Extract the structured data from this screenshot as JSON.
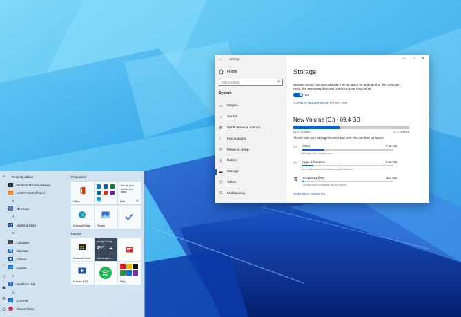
{
  "settings": {
    "app_title": "Settings",
    "home_label": "Home",
    "search_placeholder": "Find a setting",
    "section_label": "System",
    "nav": [
      {
        "label": "Display",
        "icon": "display-icon"
      },
      {
        "label": "Sound",
        "icon": "sound-icon"
      },
      {
        "label": "Notifications & actions",
        "icon": "notifications-icon"
      },
      {
        "label": "Focus assist",
        "icon": "focus-assist-icon"
      },
      {
        "label": "Power & sleep",
        "icon": "power-icon"
      },
      {
        "label": "Battery",
        "icon": "battery-icon"
      },
      {
        "label": "Storage",
        "icon": "storage-icon",
        "active": true
      },
      {
        "label": "Tablet",
        "icon": "tablet-icon"
      },
      {
        "label": "Multitasking",
        "icon": "multitasking-icon"
      }
    ],
    "page_title": "Storage",
    "sense_description": "Storage Sense can automatically free up space by getting rid of files you don't need, like temporary files and content in your recycle bin.",
    "toggle_state": "On",
    "configure_link": "Configure Storage Sense or run it now",
    "volume": {
      "title": "New Volume (C:) - 69.4 GB",
      "used_label": "21.6 GB used",
      "free_label": "57.6 GB free",
      "used_fraction": 0.4,
      "info": "This is how your storage is used and how you can free up space."
    },
    "categories": [
      {
        "name": "Other",
        "size": "7.49 GB",
        "sub": "Manage other large folders",
        "fraction": 0.24,
        "icon": "folder-icon"
      },
      {
        "name": "Apps & features",
        "size": "2.85 GB",
        "sub": "Uninstall unused or undesired apps & features",
        "fraction": 0.12,
        "icon": "apps-icon"
      },
      {
        "name": "Temporary files",
        "size": "301 MB",
        "sub": "Choose which temporary files to remove",
        "fraction": 0.02,
        "icon": "trash-icon"
      }
    ],
    "more_link": "Show more categories"
  },
  "start_menu": {
    "recently_added": "Recently added",
    "apps": [
      {
        "name": "Windows Terminal Preview",
        "color": "#2b2b2b"
      },
      {
        "name": "XAMPP Control Panel",
        "color": "#f37b1d"
      },
      {
        "letter": "#"
      },
      {
        "name": "3D Viewer",
        "color": "#4a6fa5"
      },
      {
        "letter": "A"
      },
      {
        "name": "Alarms & Clock",
        "color": "#1c4d8c"
      },
      {
        "letter": "C"
      },
      {
        "name": "Calculator",
        "color": "#444444"
      },
      {
        "name": "Calendar",
        "color": "#1f6fd1"
      },
      {
        "name": "Camera",
        "color": "#1b4f8a"
      },
      {
        "name": "Cortana",
        "color": "#1e75d6"
      },
      {
        "letter": "F"
      },
      {
        "name": "Feedback Hub",
        "color": "#1f5fb8"
      },
      {
        "letter": "G"
      },
      {
        "name": "Get Help",
        "color": "#1f6fd1"
      },
      {
        "name": "Groove Music",
        "color": "#c9234a"
      }
    ],
    "groups": {
      "productivity": "Productivity",
      "explore": "Explore"
    },
    "tiles": {
      "office": "Office",
      "mail_text": "See all your mail in one place",
      "mail": "Mail",
      "edge": "Microsoft Edge",
      "photos": "Photos",
      "store": "Microsoft Store",
      "weather_cond": "Mostly Cloudy",
      "weather_temp": "49°",
      "weather_city": "Washington,...",
      "movies": "Movies & TV",
      "play": "Play"
    }
  }
}
